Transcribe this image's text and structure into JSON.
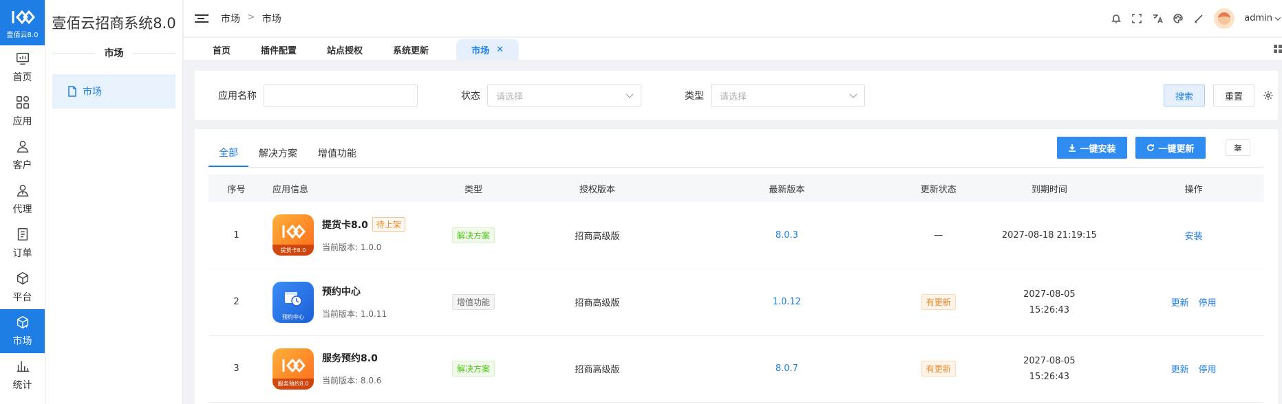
{
  "rail": {
    "logo_text": "壹佰云8.0",
    "items": [
      {
        "label": "首页",
        "icon": "monitor-icon"
      },
      {
        "label": "应用",
        "icon": "apps-grid-icon"
      },
      {
        "label": "客户",
        "icon": "user-icon"
      },
      {
        "label": "代理",
        "icon": "agent-icon"
      },
      {
        "label": "订单",
        "icon": "order-icon"
      },
      {
        "label": "平台",
        "icon": "cube-icon"
      },
      {
        "label": "市场",
        "icon": "market-box-icon"
      },
      {
        "label": "统计",
        "icon": "bar-chart-icon"
      }
    ]
  },
  "sidebar": {
    "title": "壹佰云招商系统8.0",
    "section": "市场",
    "item": "市场"
  },
  "header": {
    "breadcrumb": [
      "市场",
      "市场"
    ],
    "breadcrumb_sep": ">",
    "username": "admin"
  },
  "tabs": [
    {
      "label": "首页"
    },
    {
      "label": "插件配置"
    },
    {
      "label": "站点授权"
    },
    {
      "label": "系统更新"
    },
    {
      "label": "市场"
    }
  ],
  "filter": {
    "app_name_label": "应用名称",
    "status_label": "状态",
    "status_placeholder": "请选择",
    "type_label": "类型",
    "type_placeholder": "请选择",
    "search_btn": "搜索",
    "reset_btn": "重置"
  },
  "main": {
    "cat_tabs": [
      "全部",
      "解决方案",
      "增值功能"
    ],
    "install_all": "一键安装",
    "update_all": "一键更新",
    "columns": [
      "序号",
      "应用信息",
      "类型",
      "授权版本",
      "最新版本",
      "更新状态",
      "到期时间",
      "操作"
    ],
    "rows": [
      {
        "no": "1",
        "name": "提货卡8.0",
        "badge": "待上架",
        "icon_caption": "提货卡8.0",
        "current": "当前版本: 1.0.0",
        "type": "解决方案",
        "auth": "招商高级版",
        "latest": "8.0.3",
        "status": "—",
        "expire_a": "2027-08-18 21:19:15",
        "expire_b": "",
        "op1": "安装",
        "op2": ""
      },
      {
        "no": "2",
        "name": "预约中心",
        "badge": "",
        "icon_caption": "预约中心",
        "current": "当前版本: 1.0.11",
        "type": "增值功能",
        "auth": "招商高级版",
        "latest": "1.0.12",
        "status": "有更新",
        "expire_a": "2027-08-05",
        "expire_b": "15:26:43",
        "op1": "更新",
        "op2": "停用"
      },
      {
        "no": "3",
        "name": "服务预约8.0",
        "badge": "",
        "icon_caption": "服务预约8.0",
        "current": "当前版本: 8.0.6",
        "type": "解决方案",
        "auth": "招商高级版",
        "latest": "8.0.7",
        "status": "有更新",
        "expire_a": "2027-08-05",
        "expire_b": "15:26:43",
        "op1": "更新",
        "op2": "停用"
      }
    ]
  },
  "colors": {
    "primary": "#1e7ee6",
    "button_blue": "#2f8cf0",
    "solution_tag": "#52c41a",
    "update_tag": "#e6892d"
  }
}
